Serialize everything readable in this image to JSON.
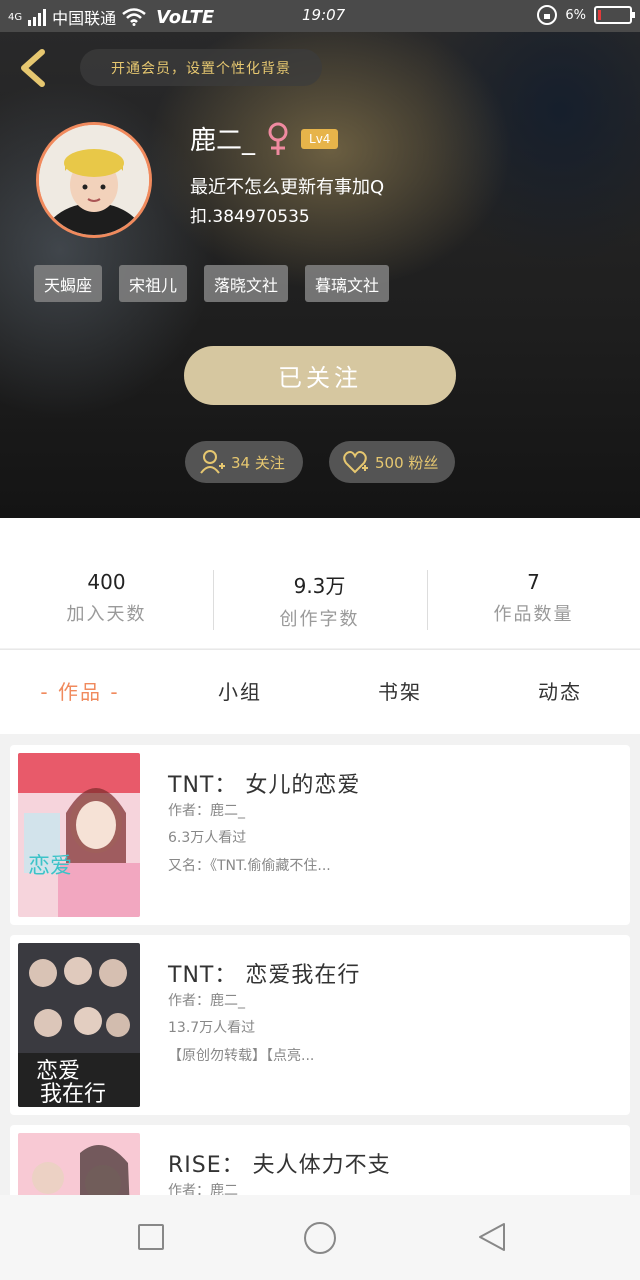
{
  "status_bar": {
    "network": "4G",
    "carrier": "中国联通",
    "volte": "VoLTE",
    "time": "19:07",
    "battery": "6%"
  },
  "header": {
    "vip_banner": "开通会员，设置个性化背景",
    "user_name": "鹿二_",
    "level": "Lv4",
    "bio": "最近不怎么更新有事加Q",
    "qq": "扣.384970535",
    "tags": [
      "天蝎座",
      "宋祖儿",
      "落晓文社",
      "暮璃文社"
    ],
    "follow_button": "已关注",
    "following": "34 关注",
    "fans": "500 粉丝"
  },
  "stats": [
    {
      "value": "400",
      "label": "加入天数"
    },
    {
      "value": "9.3万",
      "label": "创作字数"
    },
    {
      "value": "7",
      "label": "作品数量"
    }
  ],
  "tabs": [
    "- 作品 -",
    "小组",
    "书架",
    "动态"
  ],
  "works": [
    {
      "title": "TNT： 女儿的恋爱",
      "author": "作者：鹿二_",
      "views": "6.3万人看过",
      "desc": "又名：《TNT.偷偷藏不住..."
    },
    {
      "title": "TNT： 恋爱我在行",
      "author": "作者：鹿二_",
      "views": "13.7万人看过",
      "desc": "【原创勿转载】【点亮..."
    },
    {
      "title": "RISE： 夫人体力不支",
      "author": "作者：鹿二_",
      "views": "",
      "desc": ""
    }
  ],
  "colors": {
    "accent": "#f08a5d",
    "gold": "#e6c770",
    "follow_btn": "#d6c7a0",
    "level_badge": "#e7b44a"
  }
}
